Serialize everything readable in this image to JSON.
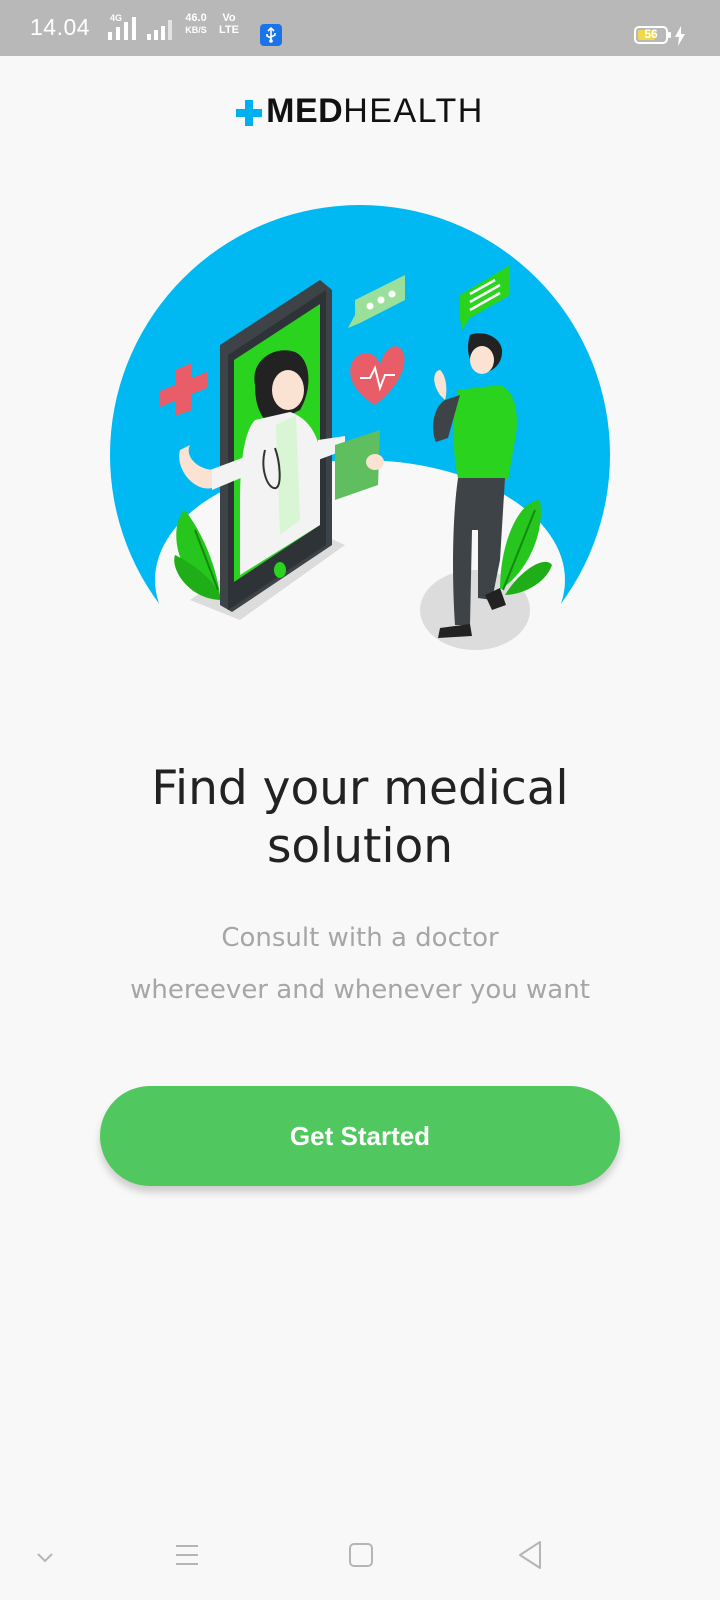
{
  "status_bar": {
    "time": "14.04",
    "network_4g": "4G",
    "speed_value": "46.0",
    "speed_unit": "KB/S",
    "volte_top": "Vo",
    "volte_bottom": "LTE",
    "battery_level": "56",
    "icons": [
      "signal-icon",
      "signal-icon",
      "usb-icon",
      "battery-icon",
      "charging-icon"
    ]
  },
  "header": {
    "logo_bold": "MED",
    "logo_light": "HEALTH"
  },
  "main": {
    "headline": "Find your medical solution",
    "subtext_line1": "Consult with a doctor",
    "subtext_line2": "whereever and whenever you want",
    "cta_label": "Get Started"
  },
  "navbar": {
    "icons": [
      "chevron-down-icon",
      "menu-icon",
      "home-square-icon",
      "back-triangle-icon"
    ]
  },
  "colors": {
    "accent_green": "#51c75f",
    "sky_blue": "#00b9f2",
    "status_bar": "#b8b8b8"
  }
}
